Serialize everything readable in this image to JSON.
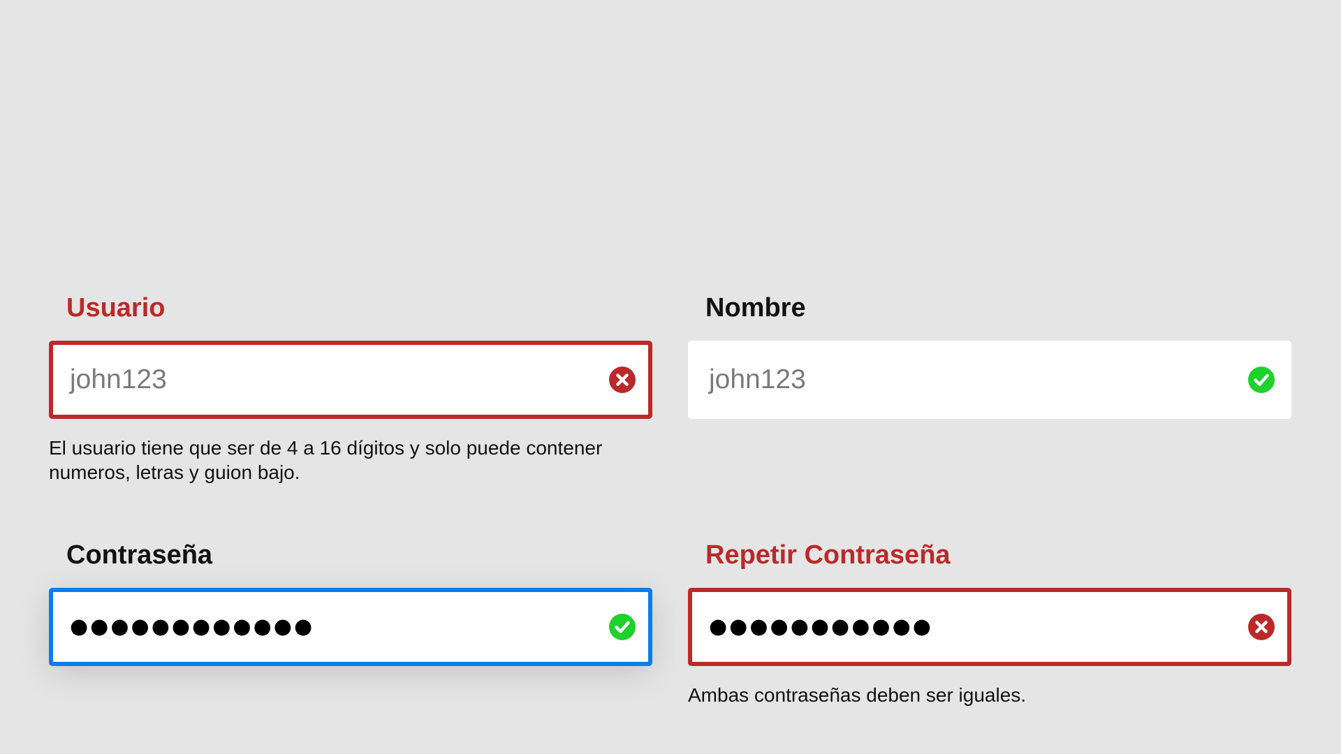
{
  "form": {
    "usuario": {
      "label": "Usuario",
      "value": "john123",
      "status": "invalid",
      "message": "El usuario tiene que ser de 4 a 16 dígitos y solo puede contener numeros, letras y guion bajo."
    },
    "nombre": {
      "label": "Nombre",
      "value": "john123",
      "status": "valid"
    },
    "password": {
      "label": "Contraseña",
      "value": "●●●●●●●●●●●●",
      "status": "valid",
      "focused": true
    },
    "password_repeat": {
      "label": "Repetir Contraseña",
      "value": "●●●●●●●●●●●",
      "status": "invalid",
      "message": "Ambas contraseñas deben ser iguales."
    }
  },
  "icons": {
    "valid": "check-circle-icon",
    "invalid": "x-circle-icon"
  },
  "colors": {
    "background": "#e5e5e5",
    "error": "#bb2929",
    "success": "#1ed12b",
    "focus": "#0a7cf2"
  }
}
